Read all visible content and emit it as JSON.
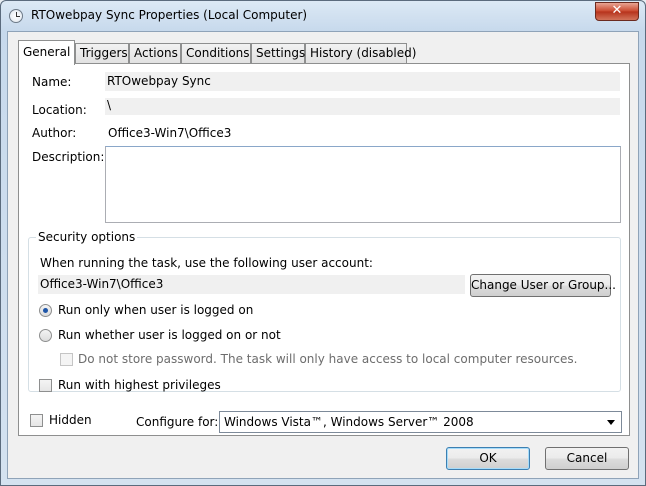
{
  "window": {
    "title": "RTOwebpay Sync Properties (Local Computer)",
    "close_glyph": "✕"
  },
  "tabs": [
    {
      "label": "General"
    },
    {
      "label": "Triggers"
    },
    {
      "label": "Actions"
    },
    {
      "label": "Conditions"
    },
    {
      "label": "Settings"
    },
    {
      "label": "History (disabled)"
    }
  ],
  "general": {
    "name_label": "Name:",
    "name_value": "RTOwebpay Sync",
    "location_label": "Location:",
    "location_value": "\\",
    "author_label": "Author:",
    "author_value": "Office3-Win7\\Office3",
    "description_label": "Description:",
    "description_value": ""
  },
  "security": {
    "group_title": "Security options",
    "account_prompt": "When running the task, use the following user account:",
    "account_value": "Office3-Win7\\Office3",
    "change_user_button": "Change User or Group...",
    "radio_logged_on": "Run only when user is logged on",
    "radio_whether": "Run whether user is logged on or not",
    "no_store_password": "Do not store password.  The task will only have access to local computer resources.",
    "highest_privileges": "Run with highest privileges"
  },
  "footer": {
    "hidden_label": "Hidden",
    "configure_label": "Configure for:",
    "configure_value": "Windows Vista™, Windows Server™ 2008"
  },
  "buttons": {
    "ok": "OK",
    "cancel": "Cancel"
  }
}
